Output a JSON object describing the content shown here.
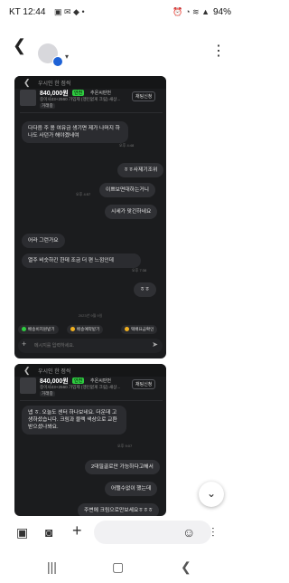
{
  "status_bar": {
    "carrier_time": "KT 12:44",
    "notification_icons": [
      "gallery-icon",
      "notification-icon",
      "chat-icon",
      "dot-icon"
    ],
    "battery": "94%"
  },
  "header": {
    "back_icon": "back-arrow-icon",
    "menu_icon": "kebab-icon"
  },
  "panel1": {
    "top_title": "우시인 한 점씩",
    "product": {
      "price": "840,000원",
      "badge": "안전",
      "badge2": "추온씨판번",
      "desc": "중이사23+2560 가입제 (맹인없게 크림) 새상...",
      "tag": "거래중",
      "button": "채팅신청"
    },
    "messages": [
      {
        "side": "left",
        "text": "다다음 주 용 여유금 생기면 제가 나머지 하나도 사던가 해야겠네여",
        "time": "오후 4:48"
      },
      {
        "side": "right",
        "text": "ㅎㅎ사제기조위"
      },
      {
        "side": "right",
        "text": "이쁘보면대하는거니",
        "time": "오후 4:57"
      },
      {
        "side": "right",
        "text": "시세가 맞긴하네요"
      },
      {
        "side": "left",
        "text": "어라 그런가요"
      },
      {
        "side": "left",
        "text": "열주 비슷하긴 한데 조금 더 편 느낌인데",
        "time": "오후 7:38"
      },
      {
        "side": "right",
        "text": "ㅎㅎ"
      }
    ],
    "date_separator": "2023년 9월 9일",
    "quick_buttons": [
      "배송비지원받기",
      "배송예약받기",
      "택배요금확인"
    ],
    "input_placeholder": "메시지를 입력하세요."
  },
  "panel2": {
    "top_title": "우시인 한 점씩",
    "product": {
      "price": "840,000원",
      "badge": "안전",
      "badge2": "추온씨판번",
      "desc": "중이사23+2560 가입제 (맹인없게 크림) 새상...",
      "tag": "거래중",
      "button": "채팅신청"
    },
    "messages": [
      {
        "side": "left",
        "text": "넵 ㅎ. 오늘도 센터 하나보네요. 더운데 고생하셨습니다. 크림과 블랙 색상으로 교환받으셨나봐요.",
        "time": "오후 9:07"
      },
      {
        "side": "right",
        "text": "2대필골로만 가능하다고해서"
      },
      {
        "side": "right",
        "text": "어쩔수없이 했는데"
      },
      {
        "side": "right",
        "text": "주변에 크림으로만보세요ㅎㅎㅎ"
      }
    ]
  },
  "composer": {
    "icons": [
      "gallery-icon",
      "camera-icon",
      "plus-icon",
      "emoji-icon",
      "voice-icon"
    ]
  },
  "navbar": {
    "icons": [
      "recent-apps-icon",
      "home-icon",
      "back-icon"
    ]
  }
}
